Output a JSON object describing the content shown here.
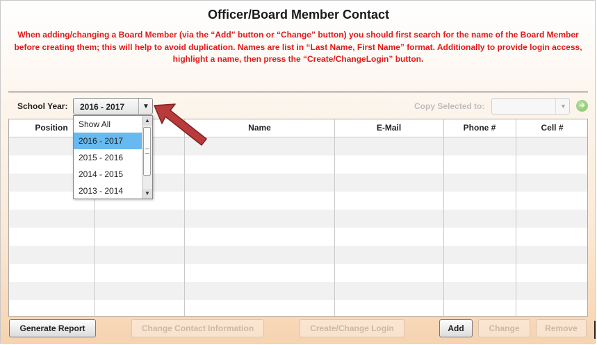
{
  "header": {
    "title": "Officer/Board Member Contact",
    "notice": "When adding/changing a Board Member (via the “Add” button or “Change” button) you should first search for the name of the Board Member before creating them; this will help to avoid duplication. Names are list in “Last Name, First Name” format. Additionally to provide login access, highlight a name, then press the “Create/ChangeLogin” button."
  },
  "toolbar": {
    "school_year_label": "School Year:",
    "school_year_value": "2016 - 2017",
    "copy_label": "Copy Selected to:",
    "copy_value": ""
  },
  "dropdown": {
    "options": [
      "Show All",
      "2016 - 2017",
      "2015 - 2016",
      "2014 - 2015",
      "2013 - 2014"
    ],
    "selected": "2016 - 2017"
  },
  "grid": {
    "columns": [
      "Position",
      "",
      "Name",
      "E-Mail",
      "Phone #",
      "Cell #"
    ],
    "rows": []
  },
  "buttons": {
    "generate_report": "Generate Report",
    "change_contact": "Change Contact Information",
    "create_login": "Create/Change Login",
    "add": "Add",
    "change": "Change",
    "remove": "Remove"
  },
  "colors": {
    "notice_text": "#e01b1b",
    "dropdown_selected": "#66baf0",
    "annotation_arrow": "#b83a3a"
  },
  "icons": [
    "chevron-down-icon",
    "go-arrow-icon",
    "scroll-up-icon",
    "scroll-down-icon",
    "annotation-arrow-icon"
  ]
}
